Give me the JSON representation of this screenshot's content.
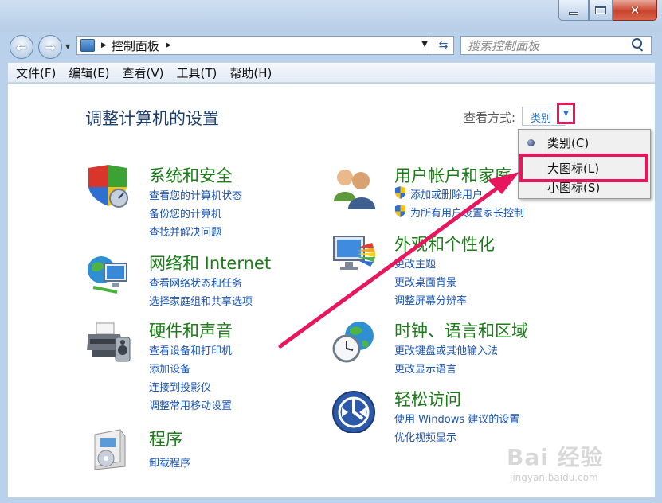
{
  "window": {
    "minimize_icon": "minimize-icon",
    "maximize_icon": "maximize-icon",
    "close_glyph": "✕"
  },
  "nav": {
    "back_glyph": "←",
    "forward_glyph": "→",
    "address_path": "控制面板",
    "search_placeholder": "搜索控制面板"
  },
  "menu": {
    "file": "文件(F)",
    "edit": "编辑(E)",
    "view": "查看(V)",
    "tools": "工具(T)",
    "help": "帮助(H)"
  },
  "main": {
    "title": "调整计算机的设置",
    "view_by_label": "查看方式:",
    "view_by_value": "类别"
  },
  "dropdown": {
    "items": [
      "类别(C)",
      "大图标(L)",
      "小图标(S)"
    ],
    "selected": "类别(C)"
  },
  "categories": {
    "system": {
      "title": "系统和安全",
      "links": [
        "查看您的计算机状态",
        "备份您的计算机",
        "查找并解决问题"
      ]
    },
    "network": {
      "title": "网络和 Internet",
      "links": [
        "查看网络状态和任务",
        "选择家庭组和共享选项"
      ]
    },
    "hardware": {
      "title": "硬件和声音",
      "links": [
        "查看设备和打印机",
        "添加设备",
        "连接到投影仪",
        "调整常用移动设置"
      ]
    },
    "programs": {
      "title": "程序",
      "links": [
        "卸载程序"
      ]
    },
    "users": {
      "title": "用户帐户和家庭",
      "links": [
        "添加或删除用户",
        "为所有用户设置家长控制"
      ]
    },
    "appearance": {
      "title": "外观和个性化",
      "links": [
        "更改主题",
        "更改桌面背景",
        "调整屏幕分辨率"
      ]
    },
    "clock": {
      "title": "时钟、语言和区域",
      "links": [
        "更改键盘或其他输入法",
        "更改显示语言"
      ]
    },
    "ease": {
      "title": "轻松访问",
      "links": [
        "使用 Windows 建议的设置",
        "优化视频显示"
      ]
    }
  },
  "watermark": {
    "brand": "Bai 经验",
    "url": "jingyan.baidu.com"
  },
  "colors": {
    "category_title": "#1b7d17",
    "link": "#1a55b5",
    "highlight": "#e8175d"
  }
}
